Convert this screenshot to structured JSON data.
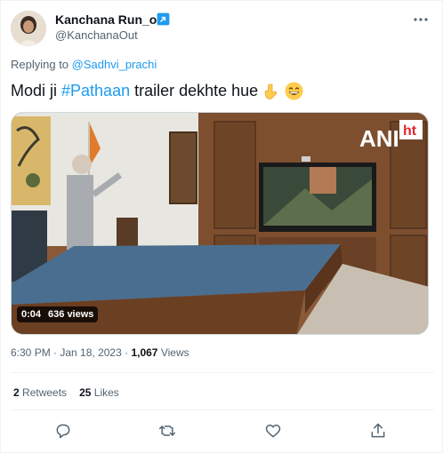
{
  "author": {
    "display_name": "Kanchana Run_out",
    "handle": "@KanchanaOut",
    "verified_badge_icon": "verified-badge-icon"
  },
  "reply": {
    "prefix": "Replying to ",
    "target": "@Sadhvi_prachi"
  },
  "tweet": {
    "text_before": "Modi ji",
    "hashtag": "#Pathaan",
    "text_after": "trailer dekhte hue",
    "emojis": [
      "backhand-index-pointing-down",
      "grinning-face-with-smiling-eyes"
    ]
  },
  "video": {
    "watermark": "ANI",
    "watermark_sup": "ht",
    "duration": "0:04",
    "views": "636 views"
  },
  "meta": {
    "time": "6:30 PM",
    "separator": " · ",
    "date": "Jan 18, 2023",
    "view_count": "1,067",
    "views_label": "Views"
  },
  "stats": {
    "retweets_count": "2",
    "retweets_label": "Retweets",
    "likes_count": "25",
    "likes_label": "Likes"
  },
  "actions": [
    "reply-icon",
    "retweet-icon",
    "like-icon",
    "share-icon"
  ],
  "colors": {
    "accent": "#1d9bf0",
    "text": "#0f1419",
    "secondary": "#536471",
    "border": "#eff3f4"
  }
}
